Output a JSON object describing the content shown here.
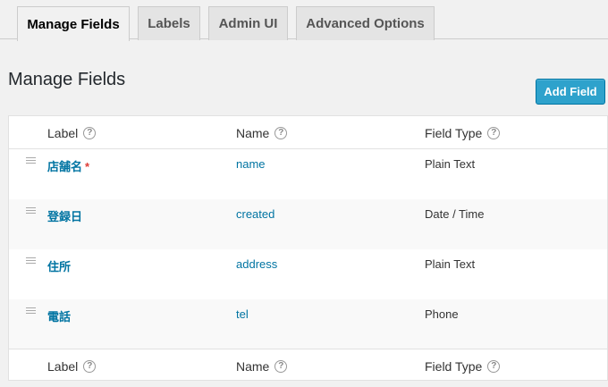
{
  "tabs": [
    "Manage Fields",
    "Labels",
    "Admin UI",
    "Advanced Options"
  ],
  "page_title": "Manage Fields",
  "add_button": "Add Field",
  "columns": {
    "label": "Label",
    "name": "Name",
    "type": "Field Type"
  },
  "help_glyph": "?",
  "required_marker": "*",
  "fields": [
    {
      "label": "店舗名",
      "name": "name",
      "type": "Plain Text",
      "required": true
    },
    {
      "label": "登録日",
      "name": "created",
      "type": "Date / Time",
      "required": false
    },
    {
      "label": "住所",
      "name": "address",
      "type": "Plain Text",
      "required": false
    },
    {
      "label": "電話",
      "name": "tel",
      "type": "Phone",
      "required": false
    }
  ],
  "colors": {
    "accent": "#2ea2cc",
    "link": "#0074a2",
    "required": "#dd3d36"
  }
}
